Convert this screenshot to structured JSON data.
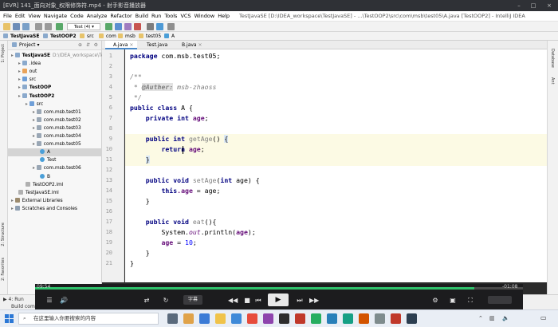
{
  "player": {
    "title": "[EVR] 141_面向对象_权限修饰符.mp4 - 射手影音播放器",
    "time_elapsed": "09:54",
    "time_remaining": "-01:08",
    "progress": 0.9,
    "subtitle_label": "字幕"
  },
  "ide": {
    "menu": [
      "File",
      "Edit",
      "View",
      "Navigate",
      "Code",
      "Analyze",
      "Refactor",
      "Build",
      "Run",
      "Tools",
      "VCS",
      "Window",
      "Help"
    ],
    "window_title": "TestJavaSE [D:\\IDEA_workspace\\TestJavaSE] - ...\\TestOOP2\\src\\com\\msb\\test05\\A.java [TestOOP2] - IntelliJ IDEA",
    "run_config": "Test (4)",
    "breadcrumbs": [
      "TestJavaSE",
      "TestOOP2",
      "src",
      "com",
      "msb",
      "test05",
      "A"
    ],
    "project_label": "Project",
    "tree": [
      {
        "label": "TestJavaSE",
        "note": "D:\\IDEA_workspace\\Test",
        "indent": 0,
        "icon": "folder",
        "bold": true
      },
      {
        "label": ".idea",
        "indent": 1,
        "icon": "folder"
      },
      {
        "label": "out",
        "indent": 1,
        "icon": "folder-orange"
      },
      {
        "label": "src",
        "indent": 1,
        "icon": "folder-blue"
      },
      {
        "label": "TestOOP",
        "indent": 1,
        "icon": "module",
        "bold": true
      },
      {
        "label": "TestOOP2",
        "indent": 1,
        "icon": "module",
        "bold": true
      },
      {
        "label": "src",
        "indent": 2,
        "icon": "folder-blue"
      },
      {
        "label": "com.msb.test01",
        "indent": 3,
        "icon": "package"
      },
      {
        "label": "com.msb.test02",
        "indent": 3,
        "icon": "package"
      },
      {
        "label": "com.msb.test03",
        "indent": 3,
        "icon": "package"
      },
      {
        "label": "com.msb.test04",
        "indent": 3,
        "icon": "package"
      },
      {
        "label": "com.msb.test05",
        "indent": 3,
        "icon": "package"
      },
      {
        "label": "A",
        "indent": 4,
        "icon": "class",
        "selected": true
      },
      {
        "label": "Test",
        "indent": 4,
        "icon": "class"
      },
      {
        "label": "com.msb.test06",
        "indent": 3,
        "icon": "package"
      },
      {
        "label": "B",
        "indent": 4,
        "icon": "class"
      },
      {
        "label": "TestOOP2.iml",
        "indent": 2,
        "icon": "iml"
      },
      {
        "label": "TestJavaSE.iml",
        "indent": 1,
        "icon": "iml"
      },
      {
        "label": "External Libraries",
        "indent": 0,
        "icon": "library"
      },
      {
        "label": "Scratches and Consoles",
        "indent": 0,
        "icon": "scratch"
      }
    ],
    "tabs": [
      "A.java",
      "Test.java",
      "B.java"
    ],
    "side_left": [
      "1: Project",
      "2: Structure",
      "2: Favorites"
    ],
    "side_right": [
      "Database",
      "Ant"
    ],
    "status_text": "Build comp",
    "run_label": "4: Run",
    "code_lines": [
      "1",
      "2",
      "3",
      "4",
      "5",
      "6",
      "7",
      "8",
      "9",
      "10",
      "11",
      "12",
      "13",
      "14",
      "15",
      "16",
      "17",
      "18",
      "19",
      "20",
      "21"
    ],
    "code": {
      "l1_kw": "package",
      "l1_rest": " com.msb.test05;",
      "l3": "/**",
      "l4_star": " * ",
      "l4_tag": "@Auther:",
      "l4_rest": " msb-zhaoss",
      "l5": " */",
      "l6_kw": "public class",
      "l6_rest": " A {",
      "l7_kw": "private int",
      "l7_fld": " age",
      ";": ";",
      "l9_kw": "public int",
      "l9_m": " getAge",
      "l9_rest": "() {",
      "l10_kw": "return",
      "l10_fld": " age",
      "l11": "}",
      "l13_kw": "public void",
      "l13_m": " setAge",
      "l13_p": "(",
      "l13_kw2": "int",
      "l13_rest": " age) {",
      "l14_kw": "this",
      "l14_fld": ".age",
      "l14_rest": " = age;",
      "l15": "}",
      "l17_kw": "public void",
      "l17_m": " eat",
      "l17_rest": "(){",
      "l18_a": "System.",
      "l18_out": "out",
      "l18_b": ".println(",
      "l18_fld": "age",
      "l18_c": ");",
      "l19_fld": "age",
      "l19_a": " = ",
      "l19_num": "10",
      "l20": "}",
      "l21": "}"
    }
  },
  "taskbar": {
    "search_placeholder": "在这里输入你要搜索的内容"
  }
}
